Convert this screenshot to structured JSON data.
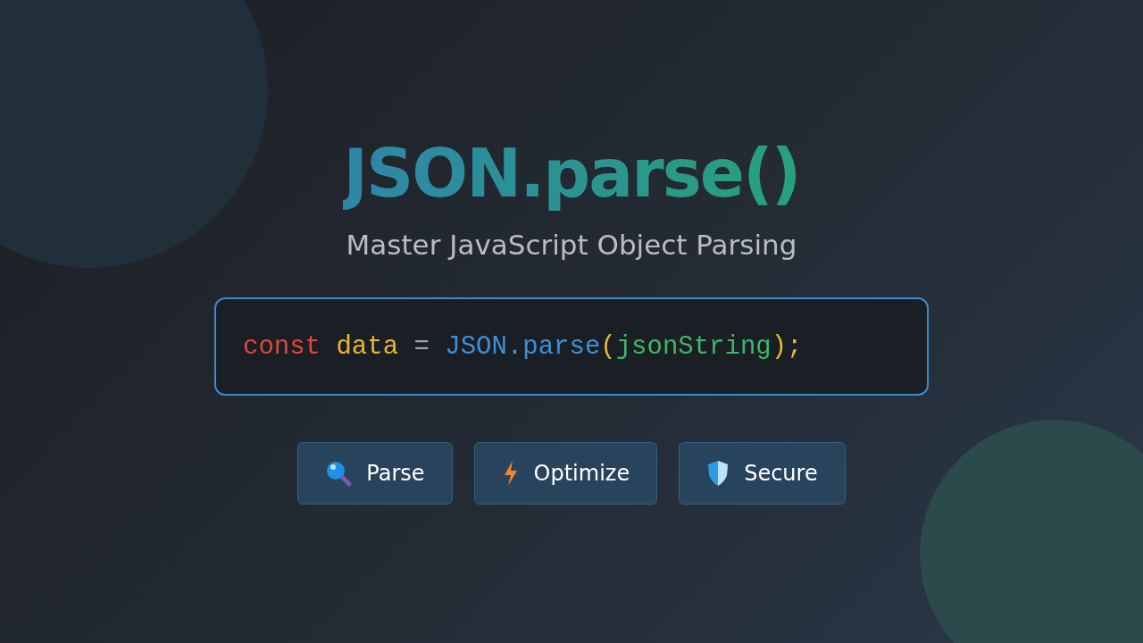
{
  "title": "JSON.parse()",
  "subtitle": "Master JavaScript Object Parsing",
  "code": [
    {
      "text": "const ",
      "color": "#e0463c"
    },
    {
      "text": "data ",
      "color": "#e9b82c"
    },
    {
      "text": "= ",
      "color": "#9aa3ad"
    },
    {
      "text": "JSON.parse",
      "color": "#3f8fd8"
    },
    {
      "text": "(",
      "color": "#e9b82c"
    },
    {
      "text": "jsonString",
      "color": "#3fb66a"
    },
    {
      "text": ");",
      "color": "#e9b82c"
    }
  ],
  "buttons": [
    {
      "label": "Parse",
      "kind": "search"
    },
    {
      "label": "Optimize",
      "kind": "bolt"
    },
    {
      "label": "Secure",
      "kind": "shield"
    }
  ]
}
